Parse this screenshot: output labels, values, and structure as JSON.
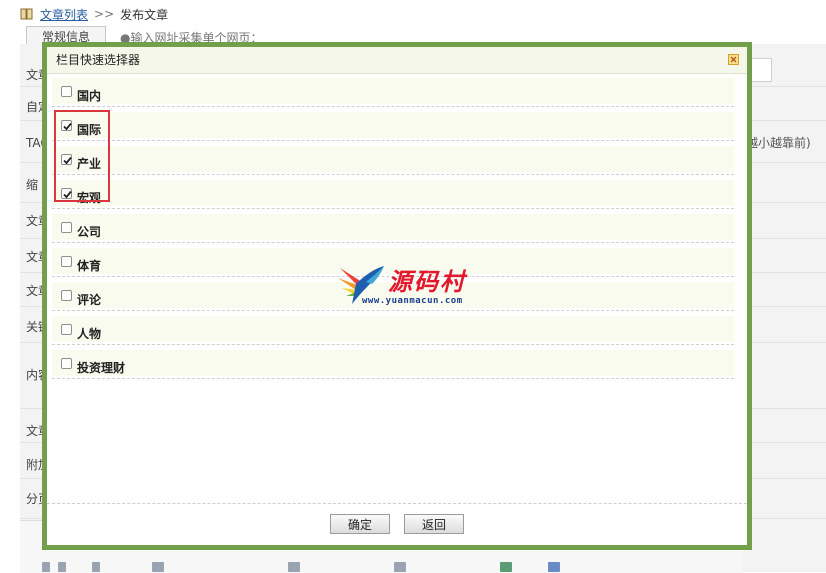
{
  "breadcrumb": {
    "link": "文章列表",
    "separator": ">>",
    "current": "发布文章"
  },
  "background": {
    "tab_label": "常规信息",
    "tab_hint": "●输入网址采集单个网页：",
    "field_labels": [
      "文章",
      "自定",
      "TAG",
      "缩",
      "文章",
      "文章",
      "文章",
      "关键",
      "内容",
      "文章",
      "附加",
      "分页"
    ],
    "right_hint": "越小越靠前)"
  },
  "dialog": {
    "title": "栏目快速选择器",
    "categories": [
      {
        "label": "国内",
        "checked": false
      },
      {
        "label": "国际",
        "checked": true
      },
      {
        "label": "产业",
        "checked": true
      },
      {
        "label": "宏观",
        "checked": true
      },
      {
        "label": "公司",
        "checked": false
      },
      {
        "label": "体育",
        "checked": false
      },
      {
        "label": "评论",
        "checked": false
      },
      {
        "label": "人物",
        "checked": false
      },
      {
        "label": "投资理财",
        "checked": false
      }
    ],
    "ok_label": "确定",
    "back_label": "返回"
  },
  "watermark": {
    "text": "源码村",
    "url": "www.yuanmacun.com"
  },
  "colors": {
    "dialog_border": "#72a04a",
    "highlight": "#d9363e",
    "link": "#2a5d9f"
  }
}
